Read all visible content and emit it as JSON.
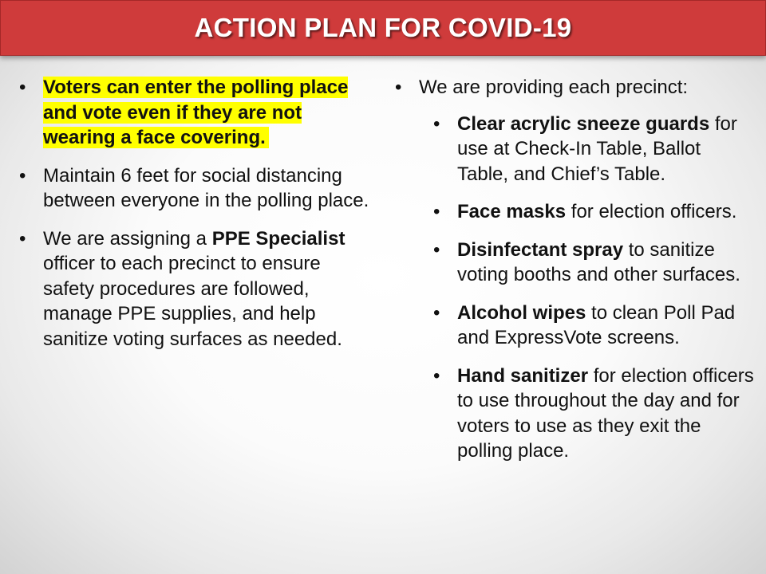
{
  "title": "ACTION PLAN FOR COVID-19",
  "left": [
    {
      "highlight": "Voters can enter the polling place and vote even if they are not wearing a face covering."
    },
    {
      "text": "Maintain 6 feet for social distancing between everyone in the polling place."
    },
    {
      "pre": "We are assigning a ",
      "bold": "PPE Specialist",
      "post": " officer to each precinct to ensure safety procedures are followed, manage PPE supplies, and help sanitize voting surfaces as needed."
    }
  ],
  "right": {
    "intro": "We are providing each precinct:",
    "items": [
      {
        "bold": "Clear acrylic sneeze guards",
        "rest": " for use at Check-In Table, Ballot Table, and Chief’s Table."
      },
      {
        "bold": "Face masks",
        "rest": " for election officers."
      },
      {
        "bold": "Disinfectant spray",
        "rest": " to sanitize voting booths and other surfaces."
      },
      {
        "bold": "Alcohol wipes",
        "rest": " to clean Poll Pad and ExpressVote screens."
      },
      {
        "bold": "Hand sanitizer",
        "rest": " for election officers to use throughout the day and for voters to use as they exit the polling place."
      }
    ]
  }
}
